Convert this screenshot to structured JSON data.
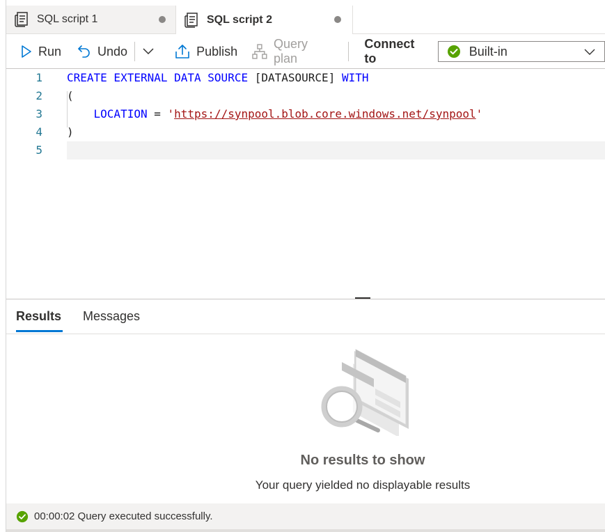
{
  "tabs": [
    {
      "label": "SQL script 1",
      "icon": "script-doc-icon",
      "unsaved": true,
      "active": false
    },
    {
      "label": "SQL script 2",
      "icon": "script-doc-icon",
      "unsaved": true,
      "active": true
    }
  ],
  "toolbar": {
    "run_label": "Run",
    "undo_label": "Undo",
    "publish_label": "Publish",
    "query_plan_label": "Query plan",
    "connect_to_label": "Connect to",
    "connection_value": "Built-in"
  },
  "editor": {
    "lines": [
      {
        "num": "1",
        "kw1": "CREATE EXTERNAL DATA SOURCE",
        "ident": " [DATASOURCE] ",
        "kw2": "WITH"
      },
      {
        "num": "2",
        "text": "("
      },
      {
        "num": "3",
        "kw": "LOCATION",
        "op": " = ",
        "q1": "'",
        "url": "https://synpool.blob.core.windows.net/synpool",
        "q2": "'"
      },
      {
        "num": "4",
        "text": ")"
      },
      {
        "num": "5",
        "text": ""
      }
    ]
  },
  "results": {
    "tab_results": "Results",
    "tab_messages": "Messages",
    "empty_title": "No results to show",
    "empty_subtitle": "Your query yielded no displayable results"
  },
  "status": {
    "message": "00:00:02 Query executed successfully."
  },
  "colors": {
    "accent": "#0078d4",
    "keyword": "#0000ff",
    "string": "#a31515",
    "line_number": "#237893",
    "success": "#57a300"
  }
}
